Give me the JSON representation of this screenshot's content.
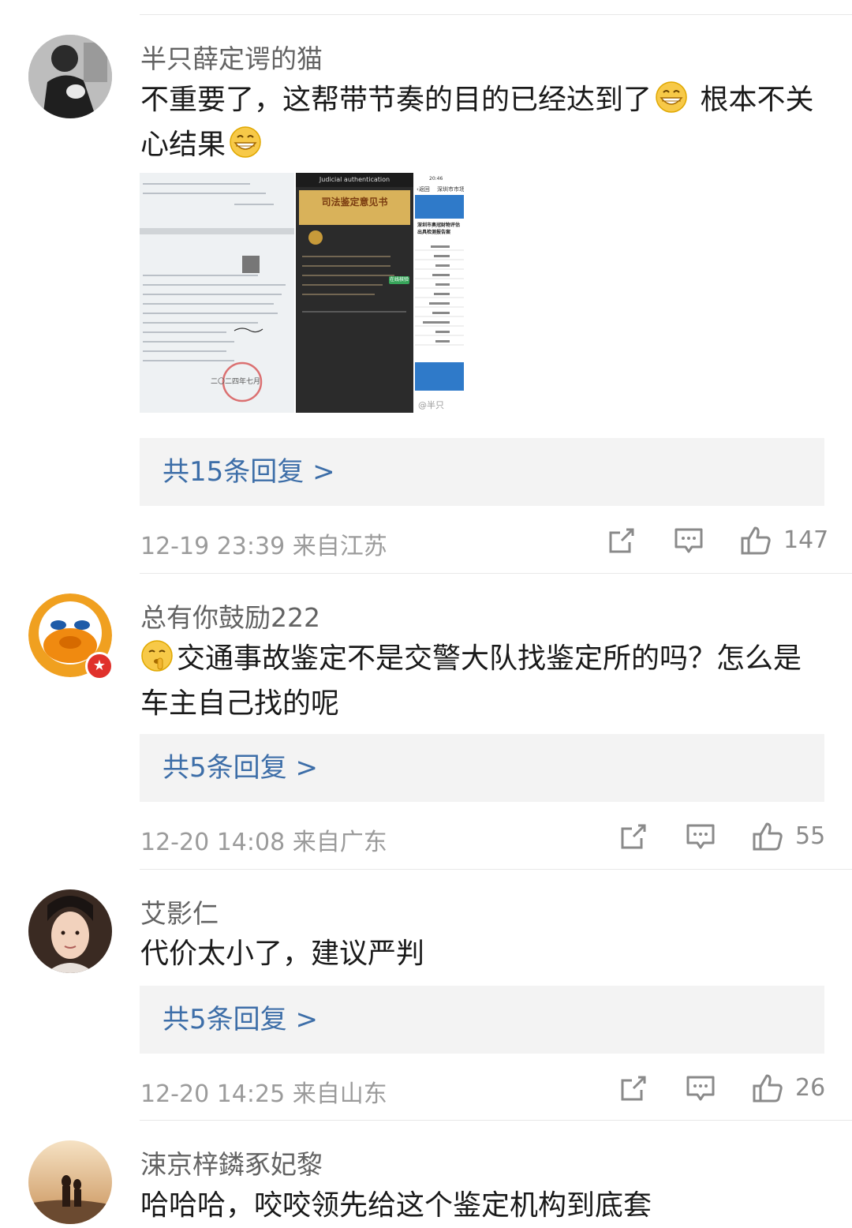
{
  "comments": [
    {
      "username": "半只薛定谔的猫",
      "text_part1": "不重要了，这帮带节奏的目的已经达到了",
      "text_part2": " 根本不关心结果",
      "images": {
        "doc_text": "二〇二四年七月",
        "app_header": "Judicial authentication",
        "app_title": "司法鉴定意见书",
        "app_verify_button": "在线核验",
        "shot_time": "20:46",
        "shot_back": "返回",
        "shot_site": "深圳市市场监",
        "shot_title": "深圳市奥冠财物评估出具检测报告案",
        "watermark": "@半只"
      },
      "replies_label": "共15条回复 >",
      "time": "12-19 23:39",
      "location": "来自江苏",
      "likes": "147"
    },
    {
      "username": "总有你鼓励222",
      "text": "交通事故鉴定不是交警大队找鉴定所的吗？怎么是车主自己找的呢",
      "replies_label": "共5条回复 >",
      "time": "12-20 14:08",
      "location": "来自广东",
      "likes": "55"
    },
    {
      "username": "艾影仁",
      "text": "代价太小了，建议严判",
      "replies_label": "共5条回复 >",
      "time": "12-20 14:25",
      "location": "来自山东",
      "likes": "26"
    },
    {
      "username": "涑京梓鏻豖妃黎",
      "text": "哈哈哈，咬咬领先给这个鉴定机构到底套"
    }
  ],
  "colors": {
    "link": "#3d6ea8",
    "meta": "#9b9b9b",
    "reply_bg": "#f3f3f3",
    "badge": "#e0312b"
  },
  "icons": [
    "share-icon",
    "comment-icon",
    "like-icon",
    "grin-emoji",
    "shush-emoji",
    "vip-badge-icon"
  ]
}
